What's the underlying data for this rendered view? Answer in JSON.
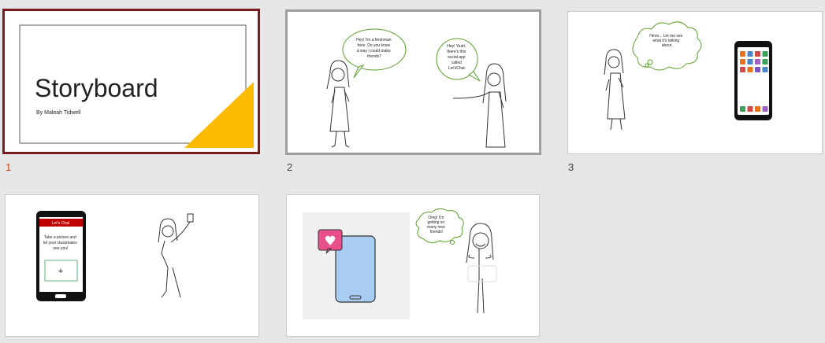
{
  "slides": [
    {
      "number": "1",
      "title": "Storyboard",
      "subtitle": "By Maleah Tidwell"
    },
    {
      "number": "2",
      "bubble_left": [
        "Hey! I'm a freshman",
        "here. Do you know",
        "a way I could make",
        "friends?"
      ],
      "bubble_right": [
        "Hey! Yeah,",
        "there's this",
        "social app",
        "called",
        "Let'sChat."
      ]
    },
    {
      "number": "3",
      "thought": [
        "Hmm... Let me see",
        "what it's talking",
        "about"
      ]
    },
    {
      "number": "",
      "app_title": "Let's Chat",
      "app_text": [
        "Take a picture and",
        "let your classmates",
        "see you!"
      ],
      "plus": "+"
    },
    {
      "number": "",
      "thought": [
        "Omg! I'm",
        "getting so",
        "many new",
        "friends!"
      ]
    }
  ],
  "colors": {
    "accent": "#c0400e",
    "selected_border": "#7a1a1f",
    "triangle": "#fdbb00",
    "bubble": "#5aa02c"
  },
  "app_colors": [
    "#e8731a",
    "#4a86c8",
    "#d24a4a",
    "#3aa05a",
    "#e8731a",
    "#4a86c8",
    "#a060c0",
    "#3aa05a",
    "#d24a4a",
    "#e8731a",
    "#7a55c0",
    "#4a86c8",
    "#3aa05a",
    "#d24a4a",
    "#e8731a",
    "#a060c0"
  ]
}
